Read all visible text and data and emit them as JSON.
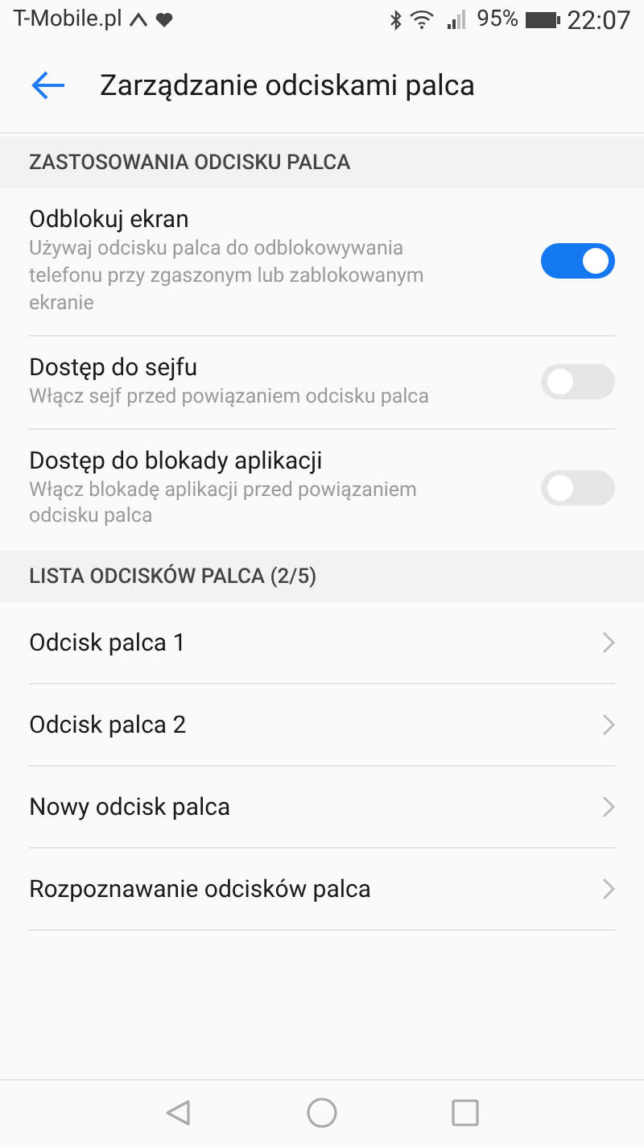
{
  "status_bar": {
    "carrier": "T-Mobile.pl",
    "battery": "95%",
    "time": "22:07"
  },
  "app_bar": {
    "title": "Zarządzanie odciskami palca"
  },
  "sections": [
    {
      "header": "ZASTOSOWANIA ODCISKU PALCA",
      "items": [
        {
          "kind": "toggle",
          "title": "Odblokuj ekran",
          "subtitle": "Używaj odcisku palca do odblokowywania telefonu przy zgaszonym lub zablokowanym ekranie",
          "on": true
        },
        {
          "kind": "toggle",
          "title": "Dostęp do sejfu",
          "subtitle": "Włącz sejf przed powiązaniem odcisku palca",
          "on": false
        },
        {
          "kind": "toggle",
          "title": "Dostęp do blokady aplikacji",
          "subtitle": "Włącz blokadę aplikacji przed powiązaniem odcisku palca",
          "on": false
        }
      ]
    },
    {
      "header": "LISTA ODCISKÓW PALCA (2/5)",
      "items": [
        {
          "kind": "link",
          "title": "Odcisk palca 1"
        },
        {
          "kind": "link",
          "title": "Odcisk palca 2"
        },
        {
          "kind": "link",
          "title": "Nowy odcisk palca"
        },
        {
          "kind": "link",
          "title": "Rozpoznawanie odcisków palca"
        }
      ]
    }
  ]
}
